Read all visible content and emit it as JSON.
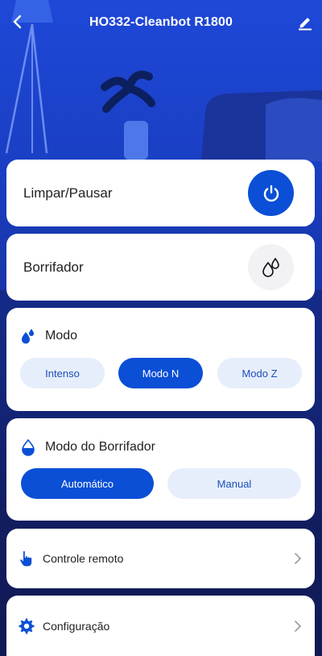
{
  "header": {
    "title": "HO332-Cleanbot R1800"
  },
  "clean_card": {
    "label": "Limpar/Pausar"
  },
  "mop_card": {
    "label": "Borrifador"
  },
  "mode_card": {
    "label": "Modo",
    "options": [
      "Intenso",
      "Modo N",
      "Modo Z"
    ],
    "selected": "Modo N"
  },
  "spray_card": {
    "label": "Modo do Borrifador",
    "options": [
      "Automático",
      "Manual"
    ],
    "selected": "Automático"
  },
  "remote_card": {
    "label": "Controle remoto"
  },
  "settings_card": {
    "label": "Configuração"
  },
  "colors": {
    "accent": "#0a4fd6",
    "pill_bg": "#e6eefb",
    "card_bg": "#ffffff"
  }
}
